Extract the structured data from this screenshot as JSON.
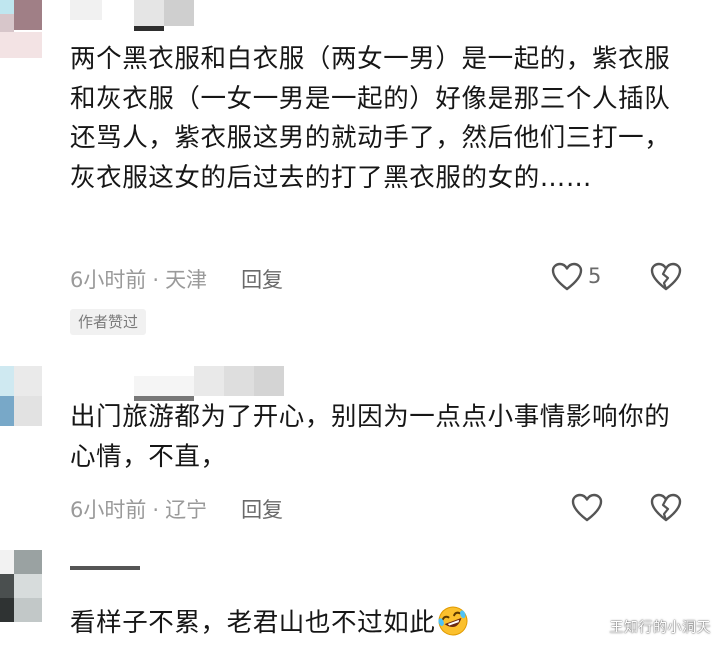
{
  "comments": [
    {
      "text": "两个黑衣服和白衣服（两女一男）是一起的，紫衣服和灰衣服（一女一男是一起的）好像是那三个人插队还骂人，紫衣服这男的就动手了，然后他们三打一，灰衣服这女的后过去的打了黑衣服的女的……",
      "time": "6小时前",
      "location": "天津",
      "reply_label": "回复",
      "like_count": "5",
      "badge": "作者赞过"
    },
    {
      "text": "出门旅游都为了开心，别因为一点点小事情影响你的心情，不直，",
      "time": "6小时前",
      "location": "辽宁",
      "reply_label": "回复"
    },
    {
      "text": "看样子不累，老君山也不过如此",
      "emoji": "rolling-on-floor-laughing-emoji"
    }
  ],
  "separator": "·",
  "watermark": "王知行的小洞天",
  "colors": {
    "text": "#161616",
    "meta": "#9a9a9a",
    "reply": "#6a6a6a",
    "badge_bg": "#f1f1f1"
  }
}
